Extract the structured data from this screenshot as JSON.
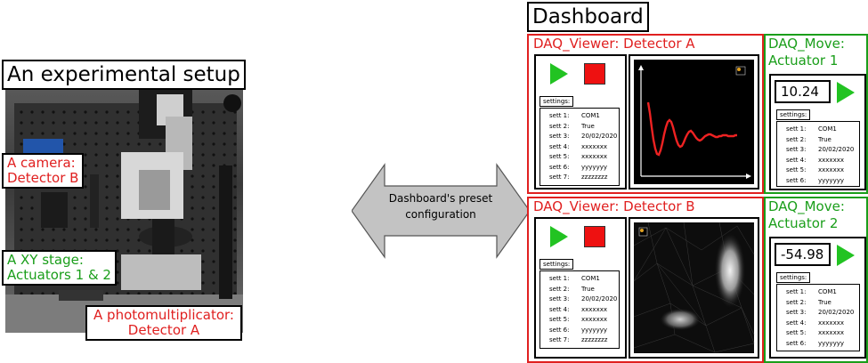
{
  "setup": {
    "title": "An experimental setup",
    "camera_label": [
      "A camera:",
      "Detector B"
    ],
    "stage_label": [
      "A XY stage:",
      "Actuators 1 & 2"
    ],
    "pmt_label": [
      "A photomultiplicator:",
      "Detector A"
    ]
  },
  "arrow_label": [
    "Dashboard's preset",
    "configuration"
  ],
  "dashboard": {
    "title": "Dashboard",
    "viewer_a": {
      "title": "DAQ_Viewer: Detector A",
      "settings_label": "settings:",
      "settings": [
        {
          "key": "sett 1:",
          "value": "COM1"
        },
        {
          "key": "sett 2:",
          "value": "True"
        },
        {
          "key": "sett 3:",
          "value": "20/02/2020"
        },
        {
          "key": "sett 4:",
          "value": "xxxxxxx"
        },
        {
          "key": "sett 5:",
          "value": "xxxxxxx"
        },
        {
          "key": "sett 6:",
          "value": "yyyyyyy"
        },
        {
          "key": "sett 7:",
          "value": "zzzzzzzz"
        }
      ]
    },
    "viewer_b": {
      "title": "DAQ_Viewer: Detector B",
      "settings_label": "settings:",
      "settings": [
        {
          "key": "sett 1:",
          "value": "COM1"
        },
        {
          "key": "sett 2:",
          "value": "True"
        },
        {
          "key": "sett 3:",
          "value": "20/02/2020"
        },
        {
          "key": "sett 4:",
          "value": "xxxxxxx"
        },
        {
          "key": "sett 5:",
          "value": "xxxxxxx"
        },
        {
          "key": "sett 6:",
          "value": "yyyyyyy"
        },
        {
          "key": "sett 7:",
          "value": "zzzzzzzz"
        }
      ]
    },
    "move_1": {
      "title": [
        "DAQ_Move:",
        "Actuator 1"
      ],
      "value": "10.24",
      "settings_label": "settings:",
      "settings": [
        {
          "key": "sett 1:",
          "value": "COM1"
        },
        {
          "key": "sett 2:",
          "value": "True"
        },
        {
          "key": "sett 3:",
          "value": "20/02/2020"
        },
        {
          "key": "sett 4:",
          "value": "xxxxxxx"
        },
        {
          "key": "sett 5:",
          "value": "xxxxxxx"
        },
        {
          "key": "sett 6:",
          "value": "yyyyyyy"
        }
      ]
    },
    "move_2": {
      "title": [
        "DAQ_Move:",
        "Actuator 2"
      ],
      "value": "-54.98",
      "settings_label": "settings:",
      "settings": [
        {
          "key": "sett 1:",
          "value": "COM1"
        },
        {
          "key": "sett 2:",
          "value": "True"
        },
        {
          "key": "sett 3:",
          "value": "20/02/2020"
        },
        {
          "key": "sett 4:",
          "value": "xxxxxxx"
        },
        {
          "key": "sett 5:",
          "value": "xxxxxxx"
        },
        {
          "key": "sett 6:",
          "value": "yyyyyyy"
        }
      ]
    }
  },
  "colors": {
    "viewer_border": "#e02020",
    "move_border": "#1a9e1a",
    "play": "#22c322",
    "stop": "#ee1111"
  }
}
